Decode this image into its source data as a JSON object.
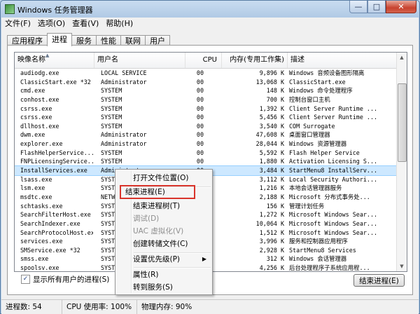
{
  "window": {
    "title": "Windows 任务管理器",
    "buttons": {
      "minimize": "—",
      "maximize": "□",
      "close": "✕"
    }
  },
  "menu": [
    "文件(F)",
    "选项(O)",
    "查看(V)",
    "帮助(H)"
  ],
  "tabs": [
    {
      "label": "应用程序",
      "active": false
    },
    {
      "label": "进程",
      "active": true
    },
    {
      "label": "服务",
      "active": false
    },
    {
      "label": "性能",
      "active": false
    },
    {
      "label": "联网",
      "active": false
    },
    {
      "label": "用户",
      "active": false
    }
  ],
  "columns": {
    "name": "映像名称",
    "user": "用户名",
    "cpu": "CPU",
    "memory": "内存(专用工作集)",
    "description": "描述",
    "sort_arrow": "▲"
  },
  "processes": [
    {
      "name": "audiodg.exe",
      "user": "LOCAL SERVICE",
      "cpu": "00",
      "memory": "9,896 K",
      "description": "Windows 音频设备图形隔离"
    },
    {
      "name": "ClassicStart.exe *32",
      "user": "Administrator",
      "cpu": "00",
      "memory": "13,068 K",
      "description": "ClassicStart.exe"
    },
    {
      "name": "cmd.exe",
      "user": "SYSTEM",
      "cpu": "00",
      "memory": "148 K",
      "description": "Windows 命令处理程序"
    },
    {
      "name": "conhost.exe",
      "user": "SYSTEM",
      "cpu": "00",
      "memory": "700 K",
      "description": "控制台窗口主机"
    },
    {
      "name": "csrss.exe",
      "user": "SYSTEM",
      "cpu": "00",
      "memory": "1,392 K",
      "description": "Client Server Runtime ..."
    },
    {
      "name": "csrss.exe",
      "user": "SYSTEM",
      "cpu": "00",
      "memory": "5,456 K",
      "description": "Client Server Runtime ..."
    },
    {
      "name": "dllhost.exe",
      "user": "SYSTEM",
      "cpu": "00",
      "memory": "3,540 K",
      "description": "COM Surrogate"
    },
    {
      "name": "dwm.exe",
      "user": "Administrator",
      "cpu": "00",
      "memory": "47,608 K",
      "description": "桌面窗口管理器"
    },
    {
      "name": "explorer.exe",
      "user": "Administrator",
      "cpu": "00",
      "memory": "28,044 K",
      "description": "Windows 资源管理器"
    },
    {
      "name": "FlashHelperService...",
      "user": "SYSTEM",
      "cpu": "00",
      "memory": "5,592 K",
      "description": "Flash Helper Service"
    },
    {
      "name": "FNPLicensingService...",
      "user": "SYSTEM",
      "cpu": "00",
      "memory": "1,880 K",
      "description": "Activation Licensing S..."
    },
    {
      "name": "InstallServices.exe",
      "user": "Administrator",
      "cpu": "00",
      "memory": "3,484 K",
      "description": "StartMenu8 InstallServ..."
    },
    {
      "name": "lsass.exe",
      "user": "SYSTEM",
      "cpu": "00",
      "memory": "3,112 K",
      "description": "Local Security Authori..."
    },
    {
      "name": "lsm.exe",
      "user": "SYSTEM",
      "cpu": "00",
      "memory": "1,216 K",
      "description": "本地会话管理器服务"
    },
    {
      "name": "msdtc.exe",
      "user": "NETWORK SERVICE",
      "cpu": "00",
      "memory": "2,188 K",
      "description": "Microsoft 分布式事务处..."
    },
    {
      "name": "schtasks.exe",
      "user": "SYSTEM",
      "cpu": "00",
      "memory": "156 K",
      "description": "管理计划任务"
    },
    {
      "name": "SearchFilterHost.exe",
      "user": "SYSTEM",
      "cpu": "00",
      "memory": "1,272 K",
      "description": "Microsoft Windows Sear..."
    },
    {
      "name": "SearchIndexer.exe",
      "user": "SYSTEM",
      "cpu": "00",
      "memory": "10,064 K",
      "description": "Microsoft Windows Sear..."
    },
    {
      "name": "SearchProtocolHost.exe",
      "user": "SYSTEM",
      "cpu": "00",
      "memory": "1,512 K",
      "description": "Microsoft Windows Sear..."
    },
    {
      "name": "services.exe",
      "user": "SYSTEM",
      "cpu": "00",
      "memory": "3,996 K",
      "description": "服务和控制器应用程序"
    },
    {
      "name": "SMService.exe *32",
      "user": "SYSTEM",
      "cpu": "00",
      "memory": "2,928 K",
      "description": "StartMenu8 Services"
    },
    {
      "name": "smss.exe",
      "user": "SYSTEM",
      "cpu": "00",
      "memory": "312 K",
      "description": "Windows 会话管理器"
    },
    {
      "name": "spoolsv.exe",
      "user": "SYSTEM",
      "cpu": "00",
      "memory": "4,256 K",
      "description": "后台处理程序子系统应用程..."
    }
  ],
  "selected_process": "InstallServices.exe",
  "context_menu": [
    {
      "label": "打开文件位置(O)",
      "disabled": false
    },
    {
      "label": "结束进程(E)",
      "disabled": false,
      "highlighted": true
    },
    {
      "label": "结束进程树(T)",
      "disabled": false
    },
    {
      "label": "调试(D)",
      "disabled": true
    },
    {
      "label": "UAC 虚拟化(V)",
      "disabled": true
    },
    {
      "label": "创建转储文件(C)",
      "disabled": false
    },
    {
      "label": "设置优先级(P)",
      "disabled": false,
      "submenu": true
    },
    {
      "label": "属性(R)",
      "disabled": false
    },
    {
      "label": "转到服务(S)",
      "disabled": false
    }
  ],
  "show_all_users": {
    "label": "显示所有用户的进程(S)",
    "checked": true,
    "check_glyph": "✓"
  },
  "end_process_button": "结束进程(E)",
  "status": {
    "processes": "进程数: 54",
    "cpu": "CPU 使用率: 100%",
    "memory": "物理内存: 90%"
  },
  "colors": {
    "highlight_border": "#d9342b",
    "selection": "#cde8ff"
  }
}
